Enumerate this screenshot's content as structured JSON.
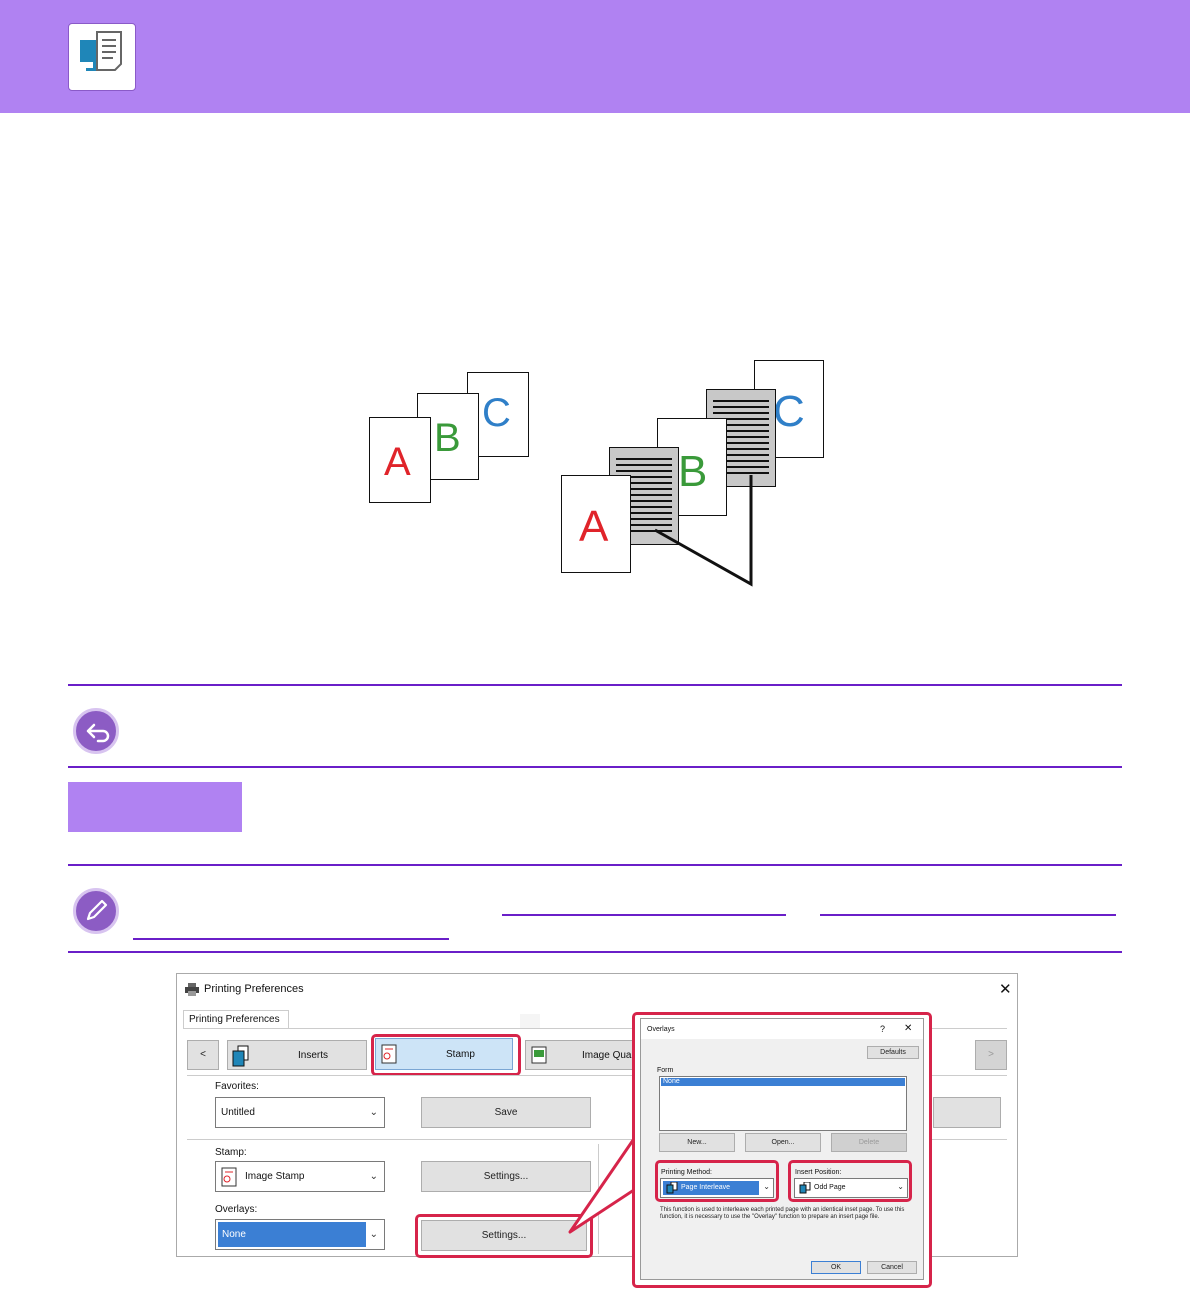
{
  "header": {
    "icon": "computer-document-icon",
    "color": "#b082f2"
  },
  "illustration": {
    "left_pages": [
      "A",
      "B",
      "C"
    ],
    "right_pages": [
      "A",
      "B",
      "C"
    ]
  },
  "window": {
    "title": "Printing Preferences",
    "close": "✕",
    "tab": "Printing Preferences",
    "nav_prev": "<",
    "nav_next": ">",
    "tabs": [
      {
        "label": "Inserts"
      },
      {
        "label": "Stamp"
      },
      {
        "label": "Image Quali"
      }
    ],
    "favorites": {
      "label": "Favorites:",
      "value": "Untitled",
      "save": "Save"
    },
    "stamp": {
      "label": "Stamp:",
      "value": "Image Stamp",
      "settings": "Settings..."
    },
    "overlays": {
      "label": "Overlays:",
      "value": "None",
      "settings": "Settings..."
    },
    "partial_letter": "F"
  },
  "overlays_dialog": {
    "title": "Overlays",
    "help": "?",
    "close": "✕",
    "defaults": "Defaults",
    "form_label": "Form",
    "form_items": [
      "None"
    ],
    "new_btn": "New...",
    "open_btn": "Open...",
    "delete_btn": "Delete",
    "printing_method": {
      "label": "Printing Method:",
      "value": "Page Interleave"
    },
    "insert_position": {
      "label": "Insert Position:",
      "value": "Odd Page"
    },
    "description": "This function is used to interleave each printed page with an identical inset page. To use this function, it is necessary to use the \"Overlay\" function to prepare an insert page file.",
    "ok": "OK",
    "cancel": "Cancel"
  },
  "colors": {
    "accent": "#b082f2",
    "rule": "#6a1fc8",
    "highlight": "#d6244a",
    "selected": "#3b7fd4"
  }
}
